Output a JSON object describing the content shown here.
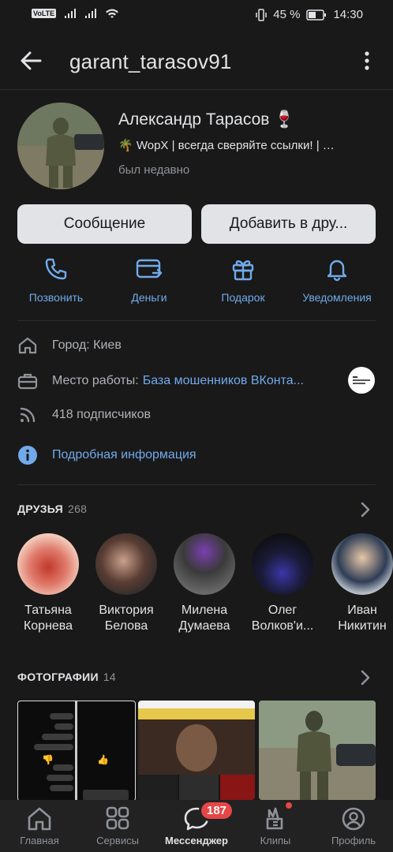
{
  "status_bar": {
    "volte": "VoLTE",
    "battery": "45 %",
    "time": "14:30"
  },
  "header": {
    "title": "garant_tarasov91"
  },
  "profile": {
    "name": "Александр Тарасов",
    "name_emoji": "🍷",
    "status_emoji": "🌴",
    "status": "WopX | всегда сверяйте ссылки! | …",
    "last_seen": "был недавно"
  },
  "buttons": {
    "message": "Сообщение",
    "add_friend": "Добавить в дру..."
  },
  "actions": [
    {
      "label": "Позвонить",
      "icon": "phone-icon"
    },
    {
      "label": "Деньги",
      "icon": "money-card-icon"
    },
    {
      "label": "Подарок",
      "icon": "gift-icon"
    },
    {
      "label": "Уведомления",
      "icon": "bell-icon"
    }
  ],
  "info": {
    "city": "Город: Киев",
    "work_label": "Место работы:",
    "work_link": "База мошенников ВКонта...",
    "followers": "418 подписчиков",
    "details": "Подробная информация"
  },
  "friends": {
    "title": "ДРУЗЬЯ",
    "count": "268",
    "items": [
      {
        "first": "Татьяна",
        "last": "Корнева"
      },
      {
        "first": "Виктория",
        "last": "Белова"
      },
      {
        "first": "Милена",
        "last": "Думаева"
      },
      {
        "first": "Олег",
        "last": "Волков'и..."
      },
      {
        "first": "Иван",
        "last": "Никитин"
      }
    ]
  },
  "photos": {
    "title": "ФОТОГРАФИИ",
    "count": "14"
  },
  "tabbar": {
    "items": [
      {
        "label": "Главная",
        "icon": "home-icon"
      },
      {
        "label": "Сервисы",
        "icon": "services-icon"
      },
      {
        "label": "Мессенджер",
        "icon": "messenger-icon"
      },
      {
        "label": "Клипы",
        "icon": "clips-icon"
      },
      {
        "label": "Профиль",
        "icon": "profile-icon"
      }
    ],
    "messenger_badge": "187"
  },
  "colors": {
    "background": "#191919",
    "accent": "#71aaeb",
    "button": "#e1e3e6",
    "badge": "#e64646"
  }
}
